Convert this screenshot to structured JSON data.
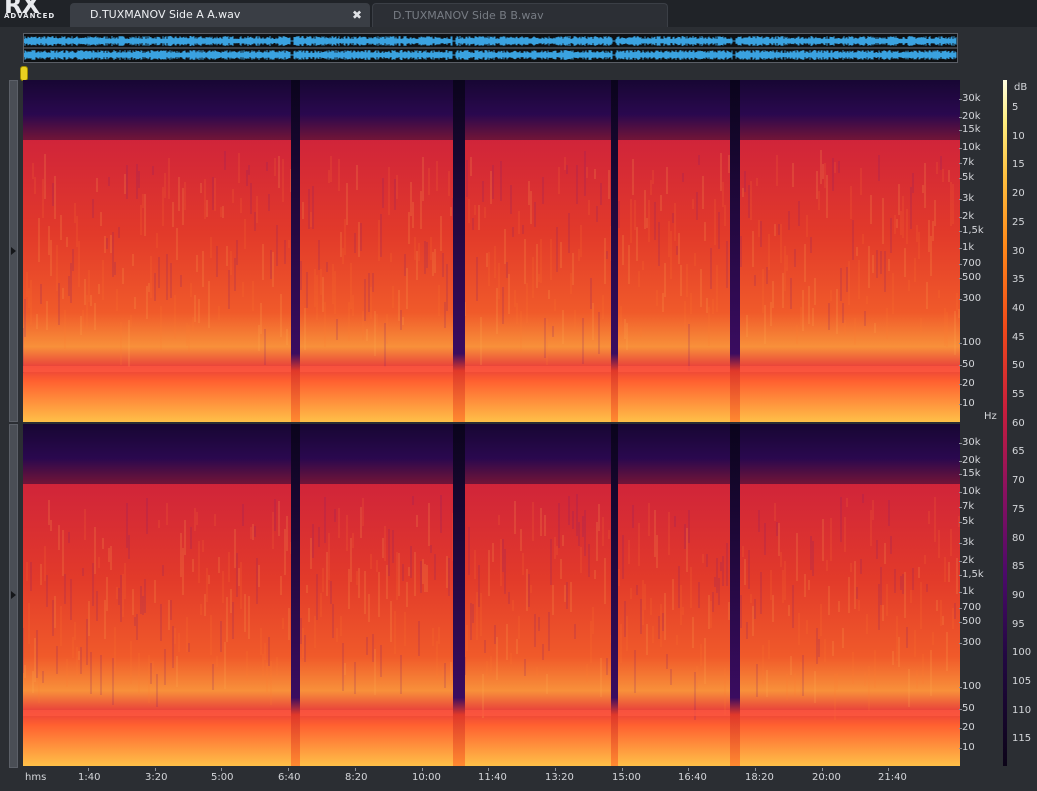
{
  "app": {
    "logo_text": "RX",
    "logo_subtext": "ADVANCED"
  },
  "tabs": [
    {
      "label": "D.TUXMANOV Side A A.wav",
      "active": true,
      "close_glyph": "✖"
    },
    {
      "label": "D.TUXMANOV Side B B.wav",
      "active": false
    }
  ],
  "frequency_axis": {
    "unit": "Hz",
    "ticks": [
      "30k",
      "20k",
      "15k",
      "10k",
      "7k",
      "5k",
      "3k",
      "2k",
      "1,5k",
      "1k",
      "700",
      "500",
      "300",
      "100",
      "50",
      "20",
      "10"
    ]
  },
  "db_scale": {
    "unit": "dB",
    "ticks": [
      "5",
      "10",
      "15",
      "20",
      "25",
      "30",
      "35",
      "40",
      "45",
      "50",
      "55",
      "60",
      "65",
      "70",
      "75",
      "80",
      "85",
      "90",
      "95",
      "100",
      "105",
      "110",
      "115"
    ]
  },
  "time_axis": {
    "unit_label": "hms",
    "ticks": [
      "1:40",
      "3:20",
      "5:00",
      "6:40",
      "8:20",
      "10:00",
      "11:40",
      "13:20",
      "15:00",
      "16:40",
      "18:20",
      "20:00",
      "21:40"
    ]
  },
  "channels": [
    "left",
    "right"
  ],
  "colors": {
    "waveform": "#3aa2e0",
    "playhead": "#e8d020",
    "background": "#2b2e33"
  },
  "icons": {
    "tab_close": "close-icon",
    "playhead": "playhead-marker-icon",
    "channel_toggle": "triangle-right-icon"
  }
}
